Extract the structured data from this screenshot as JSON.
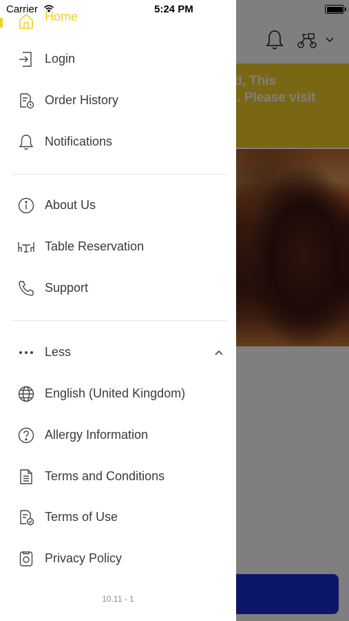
{
  "status_bar": {
    "carrier": "Carrier",
    "time": "5:24 PM"
  },
  "background": {
    "banner_lines": [
      "d, This",
      "on. Please visit"
    ]
  },
  "drawer": {
    "home_label": "Home",
    "section1": [
      {
        "label": "Login",
        "icon": "login-icon"
      },
      {
        "label": "Order History",
        "icon": "order-history-icon"
      },
      {
        "label": "Notifications",
        "icon": "bell-icon"
      }
    ],
    "section2": [
      {
        "label": "About Us",
        "icon": "info-icon"
      },
      {
        "label": "Table Reservation",
        "icon": "table-icon"
      },
      {
        "label": "Support",
        "icon": "phone-icon"
      }
    ],
    "less_label": "Less",
    "section3": [
      {
        "label": "English (United Kingdom)",
        "icon": "globe-icon"
      },
      {
        "label": "Allergy Information",
        "icon": "question-icon"
      },
      {
        "label": "Terms and Conditions",
        "icon": "document-icon"
      },
      {
        "label": "Terms of Use",
        "icon": "document-check-icon"
      },
      {
        "label": "Privacy Policy",
        "icon": "privacy-icon"
      }
    ],
    "version": "10.11 - 1"
  },
  "colors": {
    "accent": "#f2cf28",
    "primary_button": "#1b2ecf",
    "text": "#3a3a3a"
  }
}
